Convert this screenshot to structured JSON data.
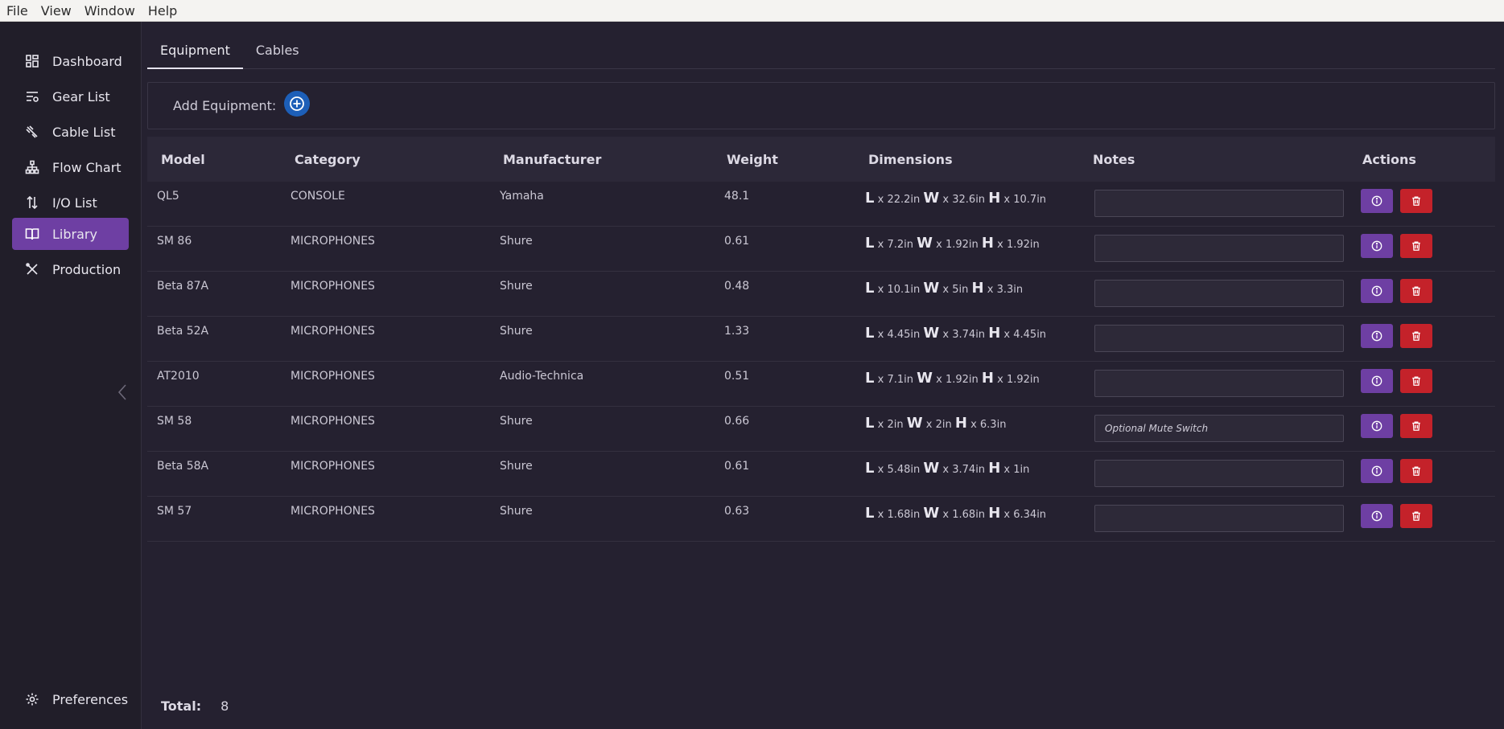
{
  "menu": [
    "File",
    "View",
    "Window",
    "Help"
  ],
  "sidebar": {
    "items": [
      {
        "label": "Dashboard",
        "icon": "dashboard-icon",
        "active": false
      },
      {
        "label": "Gear List",
        "icon": "gear-list-icon",
        "active": false
      },
      {
        "label": "Cable List",
        "icon": "cable-icon",
        "active": false
      },
      {
        "label": "Flow Chart",
        "icon": "flow-chart-icon",
        "active": false
      },
      {
        "label": "I/O List",
        "icon": "io-list-icon",
        "active": false
      },
      {
        "label": "Library",
        "icon": "book-icon",
        "active": true
      },
      {
        "label": "Production",
        "icon": "tools-icon",
        "active": false
      }
    ],
    "preferences": {
      "label": "Preferences",
      "icon": "gear-icon"
    }
  },
  "tabs": [
    {
      "label": "Equipment",
      "active": true
    },
    {
      "label": "Cables",
      "active": false
    }
  ],
  "add_equipment": {
    "label": "Add Equipment:"
  },
  "table": {
    "columns": [
      "Model",
      "Category",
      "Manufacturer",
      "Weight",
      "Dimensions",
      "Notes",
      "Actions"
    ],
    "rows": [
      {
        "model": "QL5",
        "category": "CONSOLE",
        "manufacturer": "Yamaha",
        "weight": "48.1",
        "dims": {
          "l": "22.2in",
          "w": "32.6in",
          "h": "10.7in"
        },
        "notes": ""
      },
      {
        "model": "SM 86",
        "category": "MICROPHONES",
        "manufacturer": "Shure",
        "weight": "0.61",
        "dims": {
          "l": "7.2in",
          "w": "1.92in",
          "h": "1.92in"
        },
        "notes": ""
      },
      {
        "model": "Beta 87A",
        "category": "MICROPHONES",
        "manufacturer": "Shure",
        "weight": "0.48",
        "dims": {
          "l": "10.1in",
          "w": "5in",
          "h": "3.3in"
        },
        "notes": ""
      },
      {
        "model": "Beta 52A",
        "category": "MICROPHONES",
        "manufacturer": "Shure",
        "weight": "1.33",
        "dims": {
          "l": "4.45in",
          "w": "3.74in",
          "h": "4.45in"
        },
        "notes": ""
      },
      {
        "model": "AT2010",
        "category": "MICROPHONES",
        "manufacturer": "Audio-Technica",
        "weight": "0.51",
        "dims": {
          "l": "7.1in",
          "w": "1.92in",
          "h": "1.92in"
        },
        "notes": ""
      },
      {
        "model": "SM 58",
        "category": "MICROPHONES",
        "manufacturer": "Shure",
        "weight": "0.66",
        "dims": {
          "l": "2in",
          "w": "2in",
          "h": "6.3in"
        },
        "notes": "Optional Mute Switch"
      },
      {
        "model": "Beta 58A",
        "category": "MICROPHONES",
        "manufacturer": "Shure",
        "weight": "0.61",
        "dims": {
          "l": "5.48in",
          "w": "3.74in",
          "h": "1in"
        },
        "notes": ""
      },
      {
        "model": "SM 57",
        "category": "MICROPHONES",
        "manufacturer": "Shure",
        "weight": "0.63",
        "dims": {
          "l": "1.68in",
          "w": "1.68in",
          "h": "6.34in"
        },
        "notes": ""
      }
    ]
  },
  "dim_letters": {
    "l": "L",
    "w": "W",
    "h": "H",
    "sep": "x"
  },
  "total": {
    "label": "Total:",
    "value": "8"
  },
  "colors": {
    "accent": "#6e3fa3",
    "danger": "#c4222a",
    "add": "#1d5fb8"
  }
}
